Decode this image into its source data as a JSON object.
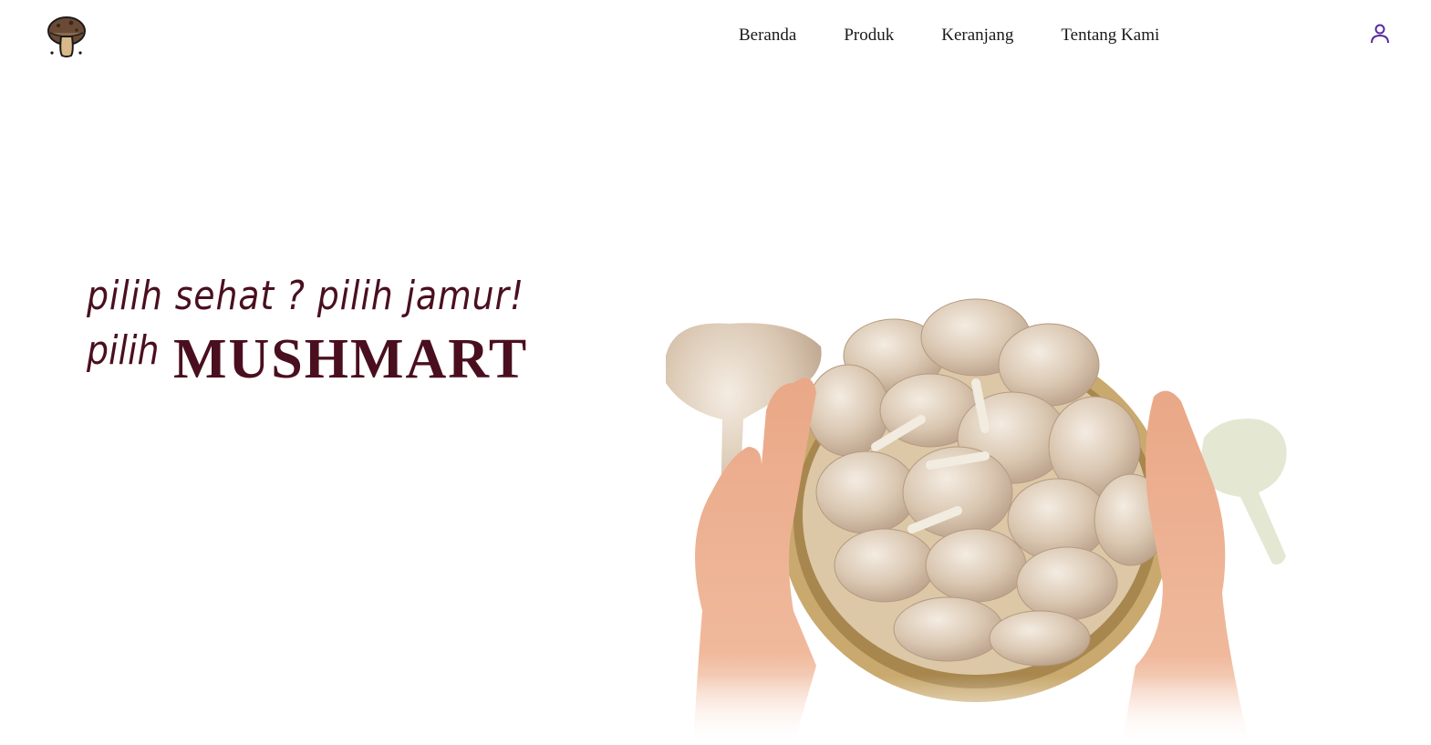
{
  "header": {
    "logo_icon": "mushroom-logo-icon",
    "nav": [
      {
        "label": "Beranda"
      },
      {
        "label": "Produk"
      },
      {
        "label": "Keranjang"
      },
      {
        "label": "Tentang Kami"
      }
    ],
    "user_icon": "user-icon"
  },
  "hero": {
    "tagline": "pilih sehat ? pilih jamur!",
    "line2_prefix": "pilih",
    "brand": "MUSHMART",
    "image": "hands-holding-basket-of-oyster-mushrooms"
  },
  "colors": {
    "brand": "#4a0f1f",
    "accent": "#5b2aa0"
  }
}
